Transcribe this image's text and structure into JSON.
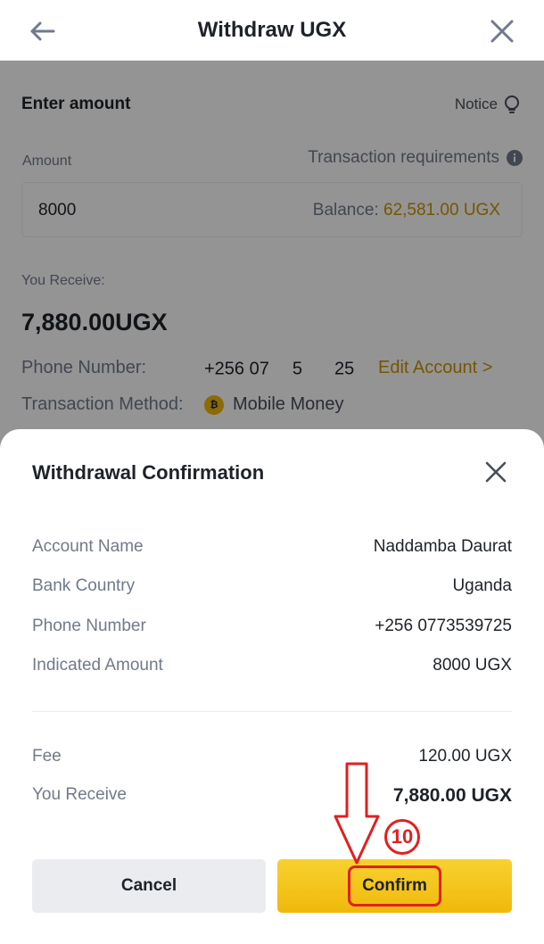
{
  "header": {
    "title": "Withdraw UGX"
  },
  "form": {
    "section_title": "Enter amount",
    "notice_label": "Notice",
    "amount_label": "Amount",
    "tx_requirements_label": "Transaction requirements",
    "amount_value": "8000",
    "balance_label": "Balance: ",
    "balance_value": "62,581.00 UGX",
    "you_receive_label": "You Receive:",
    "you_receive_value": "7,880.00UGX",
    "phone_label": "Phone Number:",
    "phone_parts": [
      "+256 07",
      "5",
      "25"
    ],
    "edit_account_label": "Edit Account >",
    "method_label": "Transaction Method:",
    "method_value": "Mobile Money"
  },
  "sheet": {
    "title": "Withdrawal Confirmation",
    "rows": [
      {
        "label": "Account Name",
        "value": "Naddamba Daurat"
      },
      {
        "label": "Bank Country",
        "value": "Uganda"
      },
      {
        "label": "Phone Number",
        "value": "+256 0773539725"
      },
      {
        "label": "Indicated Amount",
        "value": "8000 UGX"
      }
    ],
    "fee_label": "Fee",
    "fee_value": "120.00 UGX",
    "receive_label": "You Receive",
    "receive_value": "7,880.00 UGX",
    "cancel_label": "Cancel",
    "confirm_label": "Confirm"
  },
  "annotation": {
    "step_number": "10"
  },
  "colors": {
    "accent": "#f0b90b",
    "gold_text": "#c99400",
    "annotation_red": "#e02020"
  }
}
